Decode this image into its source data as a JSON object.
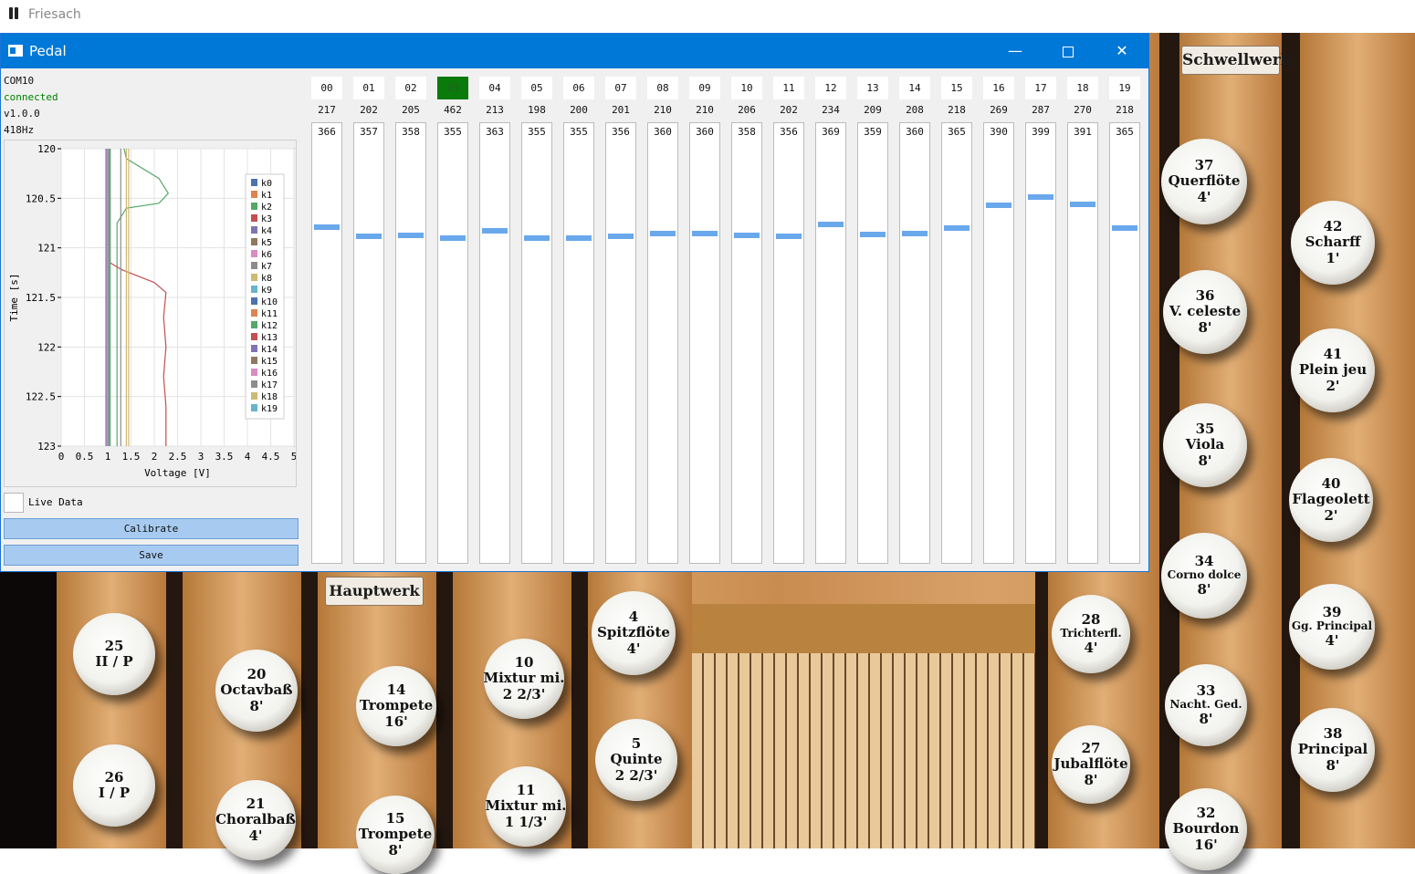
{
  "app": {
    "title": "Friesach"
  },
  "window": {
    "title": "Pedal",
    "minimize": "—",
    "close": "✕"
  },
  "device": {
    "port": "COM10",
    "status": "connected",
    "version": "v1.0.0",
    "rate": "418Hz"
  },
  "plot": {
    "ylabel": "Time [s]",
    "xlabel": "Voltage [V]",
    "yticks": [
      "120",
      "120.5",
      "121",
      "121.5",
      "122",
      "122.5",
      "123"
    ],
    "xticks": [
      "0",
      "0.5",
      "1",
      "1.5",
      "2",
      "2.5",
      "3",
      "3.5",
      "4",
      "4.5",
      "5"
    ],
    "legend": [
      "k0",
      "k1",
      "k2",
      "k3",
      "k4",
      "k5",
      "k6",
      "k7",
      "k8",
      "k9",
      "k10",
      "k11",
      "k12",
      "k13",
      "k14",
      "k15",
      "k16",
      "k17",
      "k18",
      "k19"
    ],
    "colors": [
      "#4c72b0",
      "#dd8452",
      "#55a868",
      "#c44e52",
      "#8172b3",
      "#937860",
      "#da8bc3",
      "#8c8c8c",
      "#ccb974",
      "#64b5cd",
      "#4c72b0",
      "#dd8452",
      "#55a868",
      "#c44e52",
      "#8172b3",
      "#937860",
      "#da8bc3",
      "#8c8c8c",
      "#ccb974",
      "#64b5cd"
    ]
  },
  "chart_data": {
    "type": "line",
    "xlabel": "Voltage [V]",
    "ylabel": "Time [s]",
    "xlim": [
      0,
      5
    ],
    "ylim": [
      123,
      120
    ],
    "legend_position": "top-right",
    "grid": true,
    "series": [
      {
        "name": "k0",
        "values": [
          [
            1.0,
            120
          ],
          [
            1.0,
            123
          ]
        ]
      },
      {
        "name": "k1",
        "values": [
          [
            0.98,
            120
          ],
          [
            0.98,
            123
          ]
        ]
      },
      {
        "name": "k2",
        "values": [
          [
            1.35,
            120
          ],
          [
            1.4,
            120.1
          ],
          [
            2.1,
            120.3
          ],
          [
            2.3,
            120.45
          ],
          [
            2.1,
            120.55
          ],
          [
            1.4,
            120.6
          ],
          [
            1.2,
            120.75
          ],
          [
            1.2,
            123
          ]
        ]
      },
      {
        "name": "k3",
        "values": [
          [
            1.05,
            120
          ],
          [
            1.05,
            121.15
          ],
          [
            1.3,
            121.22
          ],
          [
            2.0,
            121.35
          ],
          [
            2.25,
            121.45
          ],
          [
            2.2,
            121.7
          ],
          [
            2.25,
            122.0
          ],
          [
            2.2,
            122.3
          ],
          [
            2.25,
            122.6
          ],
          [
            2.25,
            123
          ]
        ]
      },
      {
        "name": "k4",
        "values": [
          [
            1.02,
            120
          ],
          [
            1.02,
            123
          ]
        ]
      },
      {
        "name": "k5",
        "values": [
          [
            0.96,
            120
          ],
          [
            0.96,
            123
          ]
        ]
      },
      {
        "name": "k6",
        "values": [
          [
            0.97,
            120
          ],
          [
            0.97,
            123
          ]
        ]
      },
      {
        "name": "k7",
        "values": [
          [
            1.28,
            120
          ],
          [
            1.28,
            123
          ]
        ]
      },
      {
        "name": "k8",
        "values": [
          [
            1.4,
            120
          ],
          [
            1.4,
            123
          ]
        ]
      },
      {
        "name": "k9",
        "values": [
          [
            1.0,
            120
          ],
          [
            1.0,
            123
          ]
        ]
      },
      {
        "name": "k10",
        "values": [
          [
            0.99,
            120
          ],
          [
            0.99,
            123
          ]
        ]
      },
      {
        "name": "k11",
        "values": [
          [
            1.03,
            120
          ],
          [
            1.03,
            123
          ]
        ]
      },
      {
        "name": "k12",
        "values": [
          [
            1.05,
            120
          ],
          [
            1.05,
            123
          ]
        ]
      },
      {
        "name": "k13",
        "values": [
          [
            1.0,
            120
          ],
          [
            1.0,
            123
          ]
        ]
      },
      {
        "name": "k14",
        "values": [
          [
            0.98,
            120
          ],
          [
            0.98,
            123
          ]
        ]
      },
      {
        "name": "k15",
        "values": [
          [
            1.01,
            120
          ],
          [
            1.01,
            123
          ]
        ]
      },
      {
        "name": "k16",
        "values": [
          [
            0.99,
            120
          ],
          [
            0.99,
            123
          ]
        ]
      },
      {
        "name": "k17",
        "values": [
          [
            1.02,
            120
          ],
          [
            1.02,
            123
          ]
        ]
      },
      {
        "name": "k18",
        "values": [
          [
            1.45,
            120
          ],
          [
            1.45,
            123
          ]
        ]
      },
      {
        "name": "k19",
        "values": [
          [
            1.0,
            120
          ],
          [
            1.0,
            123
          ]
        ]
      }
    ]
  },
  "controls": {
    "live_label": "Live Data",
    "live_checked": false,
    "calibrate": "Calibrate",
    "save": "Save"
  },
  "channels": [
    {
      "id": "00",
      "raw": "217",
      "cal": "366",
      "level": 0.77,
      "active": false
    },
    {
      "id": "01",
      "raw": "202",
      "cal": "357",
      "level": 0.75,
      "active": false
    },
    {
      "id": "02",
      "raw": "205",
      "cal": "358",
      "level": 0.752,
      "active": false
    },
    {
      "id": "03",
      "raw": "462",
      "cal": "355",
      "level": 0.745,
      "active": true
    },
    {
      "id": "04",
      "raw": "213",
      "cal": "363",
      "level": 0.762,
      "active": false
    },
    {
      "id": "05",
      "raw": "198",
      "cal": "355",
      "level": 0.745,
      "active": false
    },
    {
      "id": "06",
      "raw": "200",
      "cal": "355",
      "level": 0.745,
      "active": false
    },
    {
      "id": "07",
      "raw": "201",
      "cal": "356",
      "level": 0.748,
      "active": false
    },
    {
      "id": "08",
      "raw": "210",
      "cal": "360",
      "level": 0.756,
      "active": false
    },
    {
      "id": "09",
      "raw": "210",
      "cal": "360",
      "level": 0.756,
      "active": false
    },
    {
      "id": "10",
      "raw": "206",
      "cal": "358",
      "level": 0.752,
      "active": false
    },
    {
      "id": "11",
      "raw": "202",
      "cal": "356",
      "level": 0.748,
      "active": false
    },
    {
      "id": "12",
      "raw": "234",
      "cal": "369",
      "level": 0.775,
      "active": false
    },
    {
      "id": "13",
      "raw": "209",
      "cal": "359",
      "level": 0.754,
      "active": false
    },
    {
      "id": "14",
      "raw": "208",
      "cal": "360",
      "level": 0.756,
      "active": false
    },
    {
      "id": "15",
      "raw": "218",
      "cal": "365",
      "level": 0.767,
      "active": false
    },
    {
      "id": "16",
      "raw": "269",
      "cal": "390",
      "level": 0.82,
      "active": false
    },
    {
      "id": "17",
      "raw": "287",
      "cal": "399",
      "level": 0.838,
      "active": false
    },
    {
      "id": "18",
      "raw": "270",
      "cal": "391",
      "level": 0.822,
      "active": false
    },
    {
      "id": "19",
      "raw": "218",
      "cal": "365",
      "level": 0.767,
      "active": false
    }
  ],
  "organ": {
    "labels": [
      "Schwellwerk",
      "Hauptwerk"
    ],
    "stops": [
      {
        "num": "37",
        "name": "Querflöte",
        "pitch": "4'"
      },
      {
        "num": "42",
        "name": "Scharff",
        "pitch": "1'"
      },
      {
        "num": "36",
        "name": "V. celeste",
        "pitch": "8'"
      },
      {
        "num": "41",
        "name": "Plein jeu",
        "pitch": "2'"
      },
      {
        "num": "35",
        "name": "Viola",
        "pitch": "8'"
      },
      {
        "num": "40",
        "name": "Flageolett",
        "pitch": "2'"
      },
      {
        "num": "34",
        "name": "Corno dolce",
        "pitch": "8'"
      },
      {
        "num": "39",
        "name": "Gg. Principal",
        "pitch": "4'"
      },
      {
        "num": "33",
        "name": "Nacht. Ged.",
        "pitch": "8'"
      },
      {
        "num": "38",
        "name": "Principal",
        "pitch": "8'"
      },
      {
        "num": "32",
        "name": "Bourdon",
        "pitch": "16'"
      },
      {
        "num": "28",
        "name": "Trichterfl.",
        "pitch": "4'"
      },
      {
        "num": "27",
        "name": "Jubalflöte",
        "pitch": "8'"
      },
      {
        "num": "4",
        "name": "Spitzflöte",
        "pitch": "4'"
      },
      {
        "num": "5",
        "name": "Quinte",
        "pitch": "2 2/3'"
      },
      {
        "num": "10",
        "name": "Mixtur mi.",
        "pitch": "2 2/3'"
      },
      {
        "num": "11",
        "name": "Mixtur mi.",
        "pitch": "1 1/3'"
      },
      {
        "num": "14",
        "name": "Trompete",
        "pitch": "16'"
      },
      {
        "num": "15",
        "name": "Trompete",
        "pitch": "8'"
      },
      {
        "num": "20",
        "name": "Octavbaß",
        "pitch": "8'"
      },
      {
        "num": "21",
        "name": "Choralbaß",
        "pitch": "4'"
      },
      {
        "num": "25",
        "name": "II / P",
        "pitch": ""
      },
      {
        "num": "26",
        "name": "I / P",
        "pitch": ""
      }
    ]
  }
}
